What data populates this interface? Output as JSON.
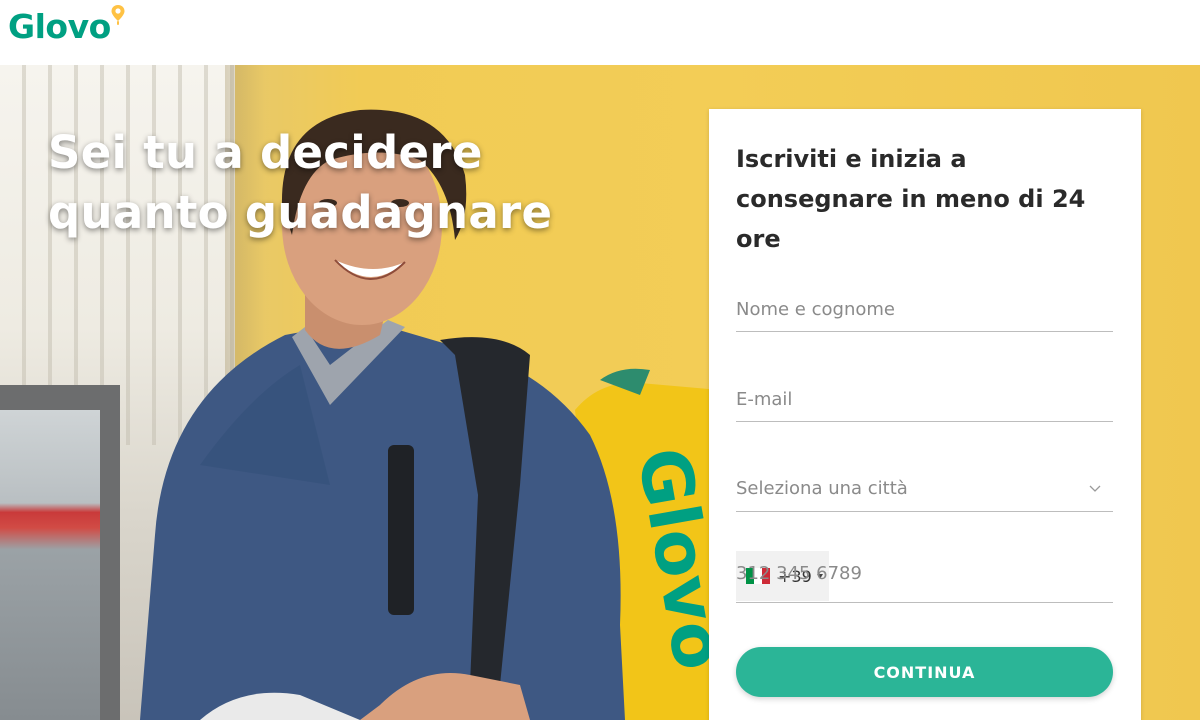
{
  "header": {
    "logo_text": "Glovo",
    "logo_icon": "location-pin-icon",
    "brand_color": "#00a082",
    "pin_color": "#ffc244"
  },
  "hero": {
    "title_line1": "Sei tu a decidere",
    "title_line2": "quanto guadagnare",
    "backpack_logo_text": "Glovo"
  },
  "form": {
    "title": "Iscriviti e inizia a consegnare in meno di 24 ore",
    "name_placeholder": "Nome e cognome",
    "email_placeholder": "E-mail",
    "city_placeholder": "Seleziona una città",
    "city_icon": "chevron-down-icon",
    "phone_country_flag": "italy-flag-icon",
    "phone_prefix": "+39",
    "phone_placeholder": "312 345 6789",
    "submit_label": "CONTINUA",
    "submit_color": "#2bb597"
  }
}
